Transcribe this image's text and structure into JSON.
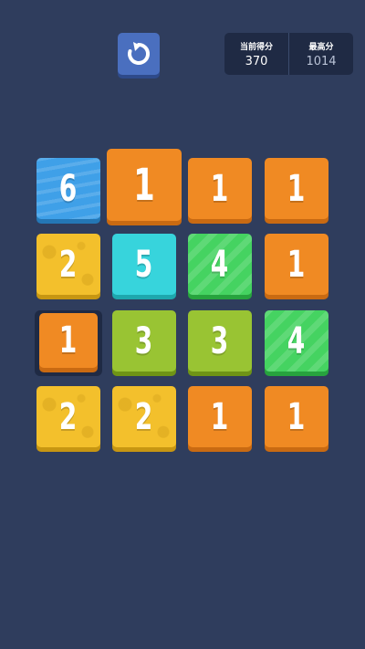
{
  "header": {
    "restart_icon": "restart-icon",
    "current_score_label": "当前得分",
    "current_score": "370",
    "best_score_label": "最高分",
    "best_score": "1014"
  },
  "board": {
    "rows": [
      [
        {
          "value": "6",
          "color": "blue",
          "pattern": "waves"
        },
        {
          "value": "1",
          "color": "orange",
          "pattern": "none",
          "raised": true
        },
        {
          "value": "1",
          "color": "orange",
          "pattern": "none"
        },
        {
          "value": "1",
          "color": "orange",
          "pattern": "none"
        }
      ],
      [
        {
          "value": "2",
          "color": "yellow",
          "pattern": "dots"
        },
        {
          "value": "5",
          "color": "cyan",
          "pattern": "none"
        },
        {
          "value": "4",
          "color": "green",
          "pattern": "stripes"
        },
        {
          "value": "1",
          "color": "orange",
          "pattern": "none"
        }
      ],
      [
        {
          "value": "1",
          "color": "orange",
          "pattern": "none",
          "selected": true
        },
        {
          "value": "3",
          "color": "olive",
          "pattern": "none"
        },
        {
          "value": "3",
          "color": "olive",
          "pattern": "none"
        },
        {
          "value": "4",
          "color": "green",
          "pattern": "stripes"
        }
      ],
      [
        {
          "value": "2",
          "color": "yellow",
          "pattern": "dots"
        },
        {
          "value": "2",
          "color": "yellow",
          "pattern": "dots"
        },
        {
          "value": "1",
          "color": "orange",
          "pattern": "none"
        },
        {
          "value": "1",
          "color": "orange",
          "pattern": "none"
        }
      ]
    ]
  },
  "colors": {
    "background": "#2f3d5d",
    "orange": "#f08a23",
    "yellow": "#f3c02c",
    "blue": "#3fa0e8",
    "cyan": "#37d4dc",
    "green": "#45d361",
    "olive": "#99c433"
  }
}
